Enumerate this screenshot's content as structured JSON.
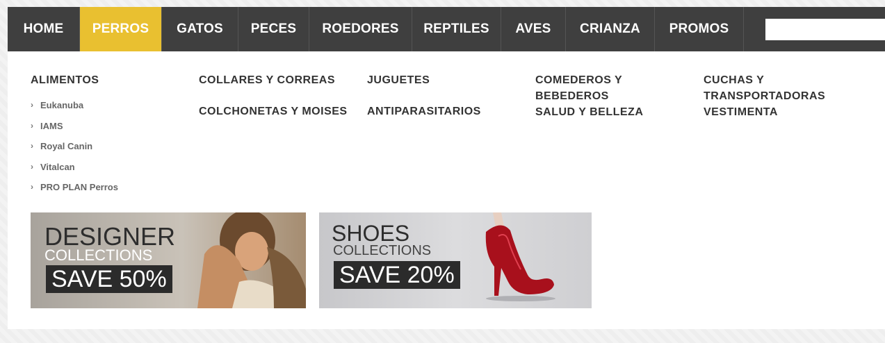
{
  "nav": {
    "items": [
      {
        "label": "HOME",
        "active": false
      },
      {
        "label": "PERROS",
        "active": true
      },
      {
        "label": "GATOS",
        "active": false
      },
      {
        "label": "PECES",
        "active": false
      },
      {
        "label": "ROEDORES",
        "active": false
      },
      {
        "label": "REPTILES",
        "active": false
      },
      {
        "label": "AVES",
        "active": false
      },
      {
        "label": "CRIANZA",
        "active": false
      },
      {
        "label": "PROMOS",
        "active": false
      }
    ],
    "search_placeholder": ""
  },
  "menu": {
    "alimentos": {
      "heading": "ALIMENTOS",
      "items": [
        "Eukanuba",
        "IAMS",
        "Royal Canin",
        "Vitalcan",
        "PRO PLAN Perros"
      ]
    },
    "col2": [
      "COLLARES Y CORREAS",
      "COLCHONETAS Y MOISES"
    ],
    "col3": [
      "JUGUETES",
      "ANTIPARASITARIOS"
    ],
    "col4": [
      "COMEDEROS Y BEBEDEROS",
      "SALUD Y BELLEZA"
    ],
    "col5": [
      "CUCHAS Y TRANSPORTADORAS",
      "VESTIMENTA"
    ]
  },
  "banners": [
    {
      "title": "DESIGNER",
      "subtitle": "COLLECTIONS",
      "save": "SAVE 50%"
    },
    {
      "title": "SHOES",
      "subtitle": "COLLECTIONS",
      "save": "SAVE 20%"
    }
  ],
  "colors": {
    "nav_bg": "#3f3f3f",
    "active": "#e9c030"
  }
}
